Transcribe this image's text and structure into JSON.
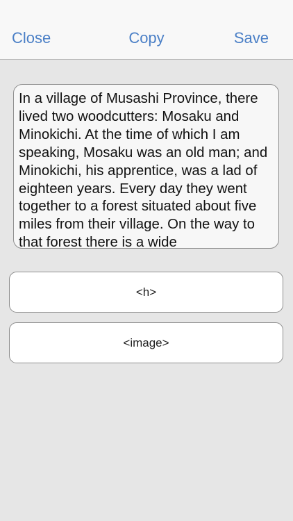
{
  "navbar": {
    "close_label": "Close",
    "copy_label": "Copy",
    "save_label": "Save"
  },
  "editor": {
    "text": "In a village of Musashi Province, there lived two woodcutters: Mosaku and Minokichi. At the time of which I am speaking, Mosaku was an old man; and Minokichi, his apprentice, was a lad of eighteen years. Every day they went together to a forest situated about five miles from their village. On the way to that forest there is a wide"
  },
  "buttons": {
    "h_label": "<h>",
    "image_label": "<image>"
  },
  "colors": {
    "accent": "#4a7fc6",
    "background": "#e6e6e6",
    "navbar": "#f8f8f8"
  }
}
